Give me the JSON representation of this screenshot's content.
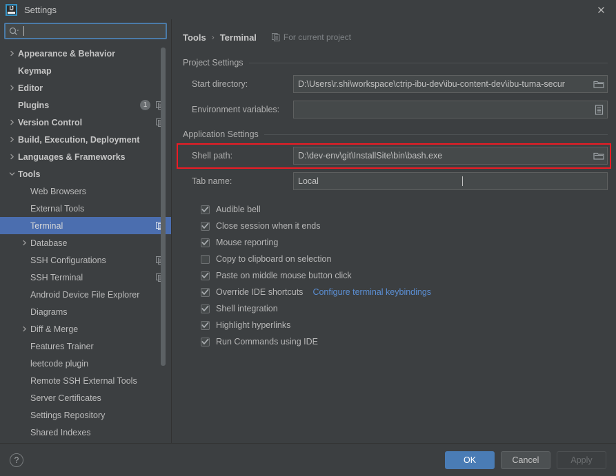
{
  "window": {
    "title": "Settings",
    "logo_icon": "intellij-idea-logo",
    "close_icon": "close-icon"
  },
  "search": {
    "icon": "search-icon",
    "value": "",
    "placeholder": ""
  },
  "sidebar": {
    "items": [
      {
        "label": "Appearance & Behavior",
        "indent": 0,
        "arrow": "collapsed",
        "bold": true,
        "badge": "",
        "project_icon": false,
        "selected": false
      },
      {
        "label": "Keymap",
        "indent": 0,
        "arrow": "none",
        "bold": true,
        "badge": "",
        "project_icon": false,
        "selected": false
      },
      {
        "label": "Editor",
        "indent": 0,
        "arrow": "collapsed",
        "bold": true,
        "badge": "",
        "project_icon": false,
        "selected": false
      },
      {
        "label": "Plugins",
        "indent": 0,
        "arrow": "none",
        "bold": true,
        "badge": "1",
        "project_icon": true,
        "selected": false
      },
      {
        "label": "Version Control",
        "indent": 0,
        "arrow": "collapsed",
        "bold": true,
        "badge": "",
        "project_icon": true,
        "selected": false
      },
      {
        "label": "Build, Execution, Deployment",
        "indent": 0,
        "arrow": "collapsed",
        "bold": true,
        "badge": "",
        "project_icon": false,
        "selected": false
      },
      {
        "label": "Languages & Frameworks",
        "indent": 0,
        "arrow": "collapsed",
        "bold": true,
        "badge": "",
        "project_icon": false,
        "selected": false
      },
      {
        "label": "Tools",
        "indent": 0,
        "arrow": "expanded",
        "bold": true,
        "badge": "",
        "project_icon": false,
        "selected": false
      },
      {
        "label": "Web Browsers",
        "indent": 1,
        "arrow": "none",
        "bold": false,
        "badge": "",
        "project_icon": false,
        "selected": false
      },
      {
        "label": "External Tools",
        "indent": 1,
        "arrow": "none",
        "bold": false,
        "badge": "",
        "project_icon": false,
        "selected": false
      },
      {
        "label": "Terminal",
        "indent": 1,
        "arrow": "none",
        "bold": false,
        "badge": "",
        "project_icon": true,
        "selected": true
      },
      {
        "label": "Database",
        "indent": 1,
        "arrow": "collapsed",
        "bold": false,
        "badge": "",
        "project_icon": false,
        "selected": false
      },
      {
        "label": "SSH Configurations",
        "indent": 1,
        "arrow": "none",
        "bold": false,
        "badge": "",
        "project_icon": true,
        "selected": false
      },
      {
        "label": "SSH Terminal",
        "indent": 1,
        "arrow": "none",
        "bold": false,
        "badge": "",
        "project_icon": true,
        "selected": false
      },
      {
        "label": "Android Device File Explorer",
        "indent": 1,
        "arrow": "none",
        "bold": false,
        "badge": "",
        "project_icon": false,
        "selected": false
      },
      {
        "label": "Diagrams",
        "indent": 1,
        "arrow": "none",
        "bold": false,
        "badge": "",
        "project_icon": false,
        "selected": false
      },
      {
        "label": "Diff & Merge",
        "indent": 1,
        "arrow": "collapsed",
        "bold": false,
        "badge": "",
        "project_icon": false,
        "selected": false
      },
      {
        "label": "Features Trainer",
        "indent": 1,
        "arrow": "none",
        "bold": false,
        "badge": "",
        "project_icon": false,
        "selected": false
      },
      {
        "label": "leetcode plugin",
        "indent": 1,
        "arrow": "none",
        "bold": false,
        "badge": "",
        "project_icon": false,
        "selected": false
      },
      {
        "label": "Remote SSH External Tools",
        "indent": 1,
        "arrow": "none",
        "bold": false,
        "badge": "",
        "project_icon": false,
        "selected": false
      },
      {
        "label": "Server Certificates",
        "indent": 1,
        "arrow": "none",
        "bold": false,
        "badge": "",
        "project_icon": false,
        "selected": false
      },
      {
        "label": "Settings Repository",
        "indent": 1,
        "arrow": "none",
        "bold": false,
        "badge": "",
        "project_icon": false,
        "selected": false
      },
      {
        "label": "Shared Indexes",
        "indent": 1,
        "arrow": "none",
        "bold": false,
        "badge": "",
        "project_icon": false,
        "selected": false
      }
    ]
  },
  "main": {
    "breadcrumb": {
      "parent": "Tools",
      "separator": "›",
      "current": "Terminal",
      "scope_note": "For current project",
      "scope_icon": "project-scope-icon"
    },
    "sections": [
      {
        "title": "Project Settings",
        "fields": [
          {
            "label": "Start directory:",
            "value": "D:\\Users\\r.shi\\workspace\\ctrip-ibu-dev\\ibu-content-dev\\ibu-tuma-secur",
            "button_icon": "folder-browse-icon",
            "highlighted": false,
            "caret": false
          },
          {
            "label": "Environment variables:",
            "value": "",
            "button_icon": "edit-list-icon",
            "highlighted": false,
            "caret": false
          }
        ]
      },
      {
        "title": "Application Settings",
        "fields": [
          {
            "label": "Shell path:",
            "value": "D:\\dev-env\\git\\InstallSite\\bin\\bash.exe",
            "button_icon": "folder-browse-icon",
            "highlighted": true,
            "caret": false
          },
          {
            "label": "Tab name:",
            "value": "Local",
            "button_icon": "",
            "highlighted": false,
            "caret": true
          }
        ]
      }
    ],
    "checkboxes": [
      {
        "label": "Audible bell",
        "checked": true,
        "link": ""
      },
      {
        "label": "Close session when it ends",
        "checked": true,
        "link": ""
      },
      {
        "label": "Mouse reporting",
        "checked": true,
        "link": ""
      },
      {
        "label": "Copy to clipboard on selection",
        "checked": false,
        "link": ""
      },
      {
        "label": "Paste on middle mouse button click",
        "checked": true,
        "link": ""
      },
      {
        "label": "Override IDE shortcuts",
        "checked": true,
        "link": "Configure terminal keybindings"
      },
      {
        "label": "Shell integration",
        "checked": true,
        "link": ""
      },
      {
        "label": "Highlight hyperlinks",
        "checked": true,
        "link": ""
      },
      {
        "label": "Run Commands using IDE",
        "checked": true,
        "link": ""
      }
    ]
  },
  "footer": {
    "help_label": "?",
    "ok_label": "OK",
    "cancel_label": "Cancel",
    "apply_label": "Apply"
  },
  "colors": {
    "background": "#3c3f41",
    "selection": "#4b6eaf",
    "accent_button": "#4a7cb5",
    "link": "#5b8fd4",
    "annotation": "#ee1b24",
    "field_background": "#45494a"
  }
}
